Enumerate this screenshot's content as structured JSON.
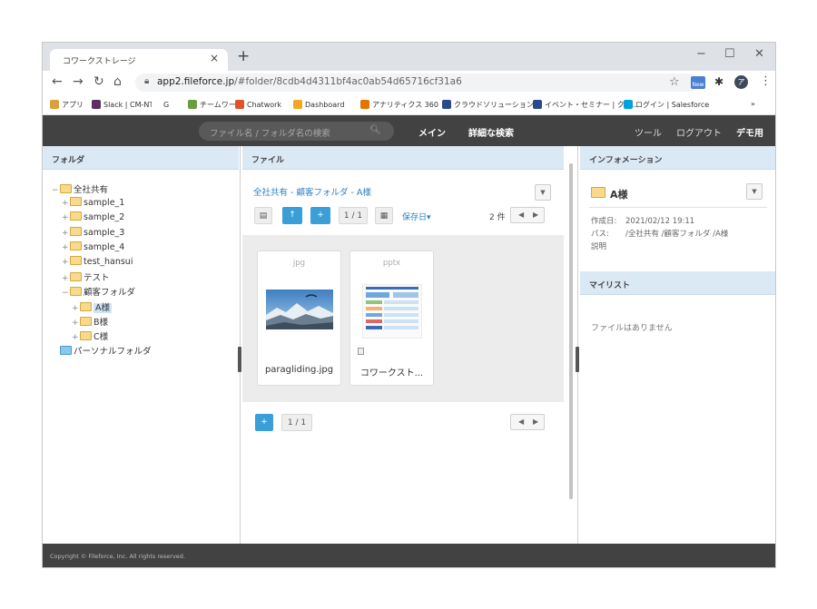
{
  "browser": {
    "tab_title": "コワークストレージ",
    "url_host": "app2.fileforce.jp",
    "url_path": "/#folder/8cdb4d4311bf4ac0ab54d65716cf31a6",
    "avatar_letter": "ア",
    "ext_label": "New",
    "bookmarks": [
      {
        "label": "アプリ",
        "color": "#d8a13a"
      },
      {
        "label": "Slack | CM-NTT",
        "color": "#5d2f63"
      },
      {
        "label": "G",
        "color": "#ffffff"
      },
      {
        "label": "チームワーク",
        "color": "#6a9e3a"
      },
      {
        "label": "Chatwork",
        "color": "#e15226"
      },
      {
        "label": "Dashboard",
        "color": "#f5a623"
      },
      {
        "label": "アナリティクス 360",
        "color": "#e37400"
      },
      {
        "label": "クラウドソリューション",
        "color": "#2a4a8a"
      },
      {
        "label": "イベント・セミナー | クラ...",
        "color": "#2a4a8a"
      },
      {
        "label": "ログイン | Salesforce",
        "color": "#00a1e0"
      },
      {
        "label": "»",
        "color": "#ffffff"
      }
    ]
  },
  "header": {
    "search_placeholder": "ファイル名 / フォルダ名の検索",
    "nav_main": "メイン",
    "nav_advanced": "詳細な検索",
    "nav_tools": "ツール",
    "nav_logout": "ログアウト",
    "nav_user": "デモ用"
  },
  "left": {
    "title": "フォルダ",
    "tree": [
      {
        "label": "全社共有",
        "toggle": "−",
        "indent": 0,
        "type": "yellow"
      },
      {
        "label": "sample_1",
        "toggle": "+",
        "indent": 1,
        "type": "yellow"
      },
      {
        "label": "sample_2",
        "toggle": "+",
        "indent": 1,
        "type": "yellow"
      },
      {
        "label": "sample_3",
        "toggle": "+",
        "indent": 1,
        "type": "yellow"
      },
      {
        "label": "sample_4",
        "toggle": "+",
        "indent": 1,
        "type": "yellow"
      },
      {
        "label": "test_hansui",
        "toggle": "+",
        "indent": 1,
        "type": "yellow"
      },
      {
        "label": "テスト",
        "toggle": "+",
        "indent": 1,
        "type": "yellow"
      },
      {
        "label": "顧客フォルダ",
        "toggle": "−",
        "indent": 1,
        "type": "yellow"
      },
      {
        "label": "A様",
        "toggle": "+",
        "indent": 2,
        "type": "yellow",
        "selected": true
      },
      {
        "label": "B様",
        "toggle": "+",
        "indent": 2,
        "type": "yellow"
      },
      {
        "label": "C様",
        "toggle": "+",
        "indent": 2,
        "type": "yellow"
      },
      {
        "label": "パーソナルフォルダ",
        "toggle": "",
        "indent": 0,
        "type": "blue"
      }
    ]
  },
  "center": {
    "title": "ファイル",
    "breadcrumb": "全社共有 - 顧客フォルダ - A様",
    "page": "1 / 1",
    "sort_label": "保存日▾",
    "count": "2 件",
    "files": [
      {
        "ext": "jpg",
        "name": "paragliding.jpg"
      },
      {
        "ext": "pptx",
        "name": "コワークスト..."
      }
    ],
    "bottom_page": "1 / 1"
  },
  "right": {
    "title": "インフォメーション",
    "folder_name": "A様",
    "created_label": "作成日:",
    "created_value": "2021/02/12 19:11",
    "path_label": "パス:",
    "path_value": "/全社共有 /顧客フォルダ /A様",
    "desc_label": "説明",
    "mylist_title": "マイリスト",
    "mylist_empty": "ファイルはありません"
  },
  "footer": {
    "copyright": "Copyright © Fileforce, Inc. All rights reserved."
  }
}
